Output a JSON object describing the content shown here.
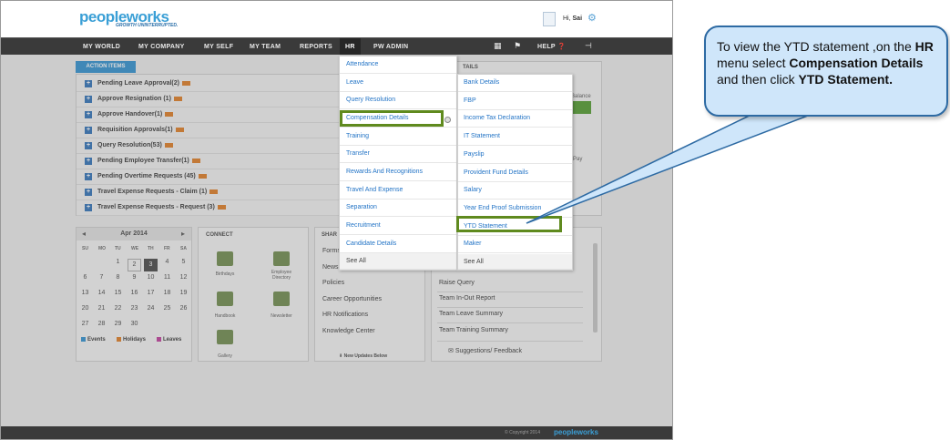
{
  "header": {
    "logo_text": "peopleworks",
    "tagline": "GROWTH UNINTERRUPTED.",
    "greeting": "Hi,",
    "user_name": "Sai"
  },
  "nav": {
    "items": [
      "MY WORLD",
      "MY COMPANY",
      "MY SELF",
      "MY TEAM",
      "REPORTS",
      "HR",
      "PW ADMIN"
    ],
    "help_label": "HELP"
  },
  "action_items": {
    "tab_label": "ACTION ITEMS",
    "rows": [
      "Pending Leave Approval(2)",
      "Approve Resignation (1)",
      "Approve Handover(1)",
      "Requisition Approvals(1)",
      "Query Resolution(53)",
      "Pending Employee Transfer(1)",
      "Pending Overtime Requests (45)",
      "Travel Expense Requests - Claim (1)",
      "Travel Expense Requests - Request (3)"
    ]
  },
  "calendar": {
    "month": "Apr 2014",
    "dow": [
      "SU",
      "MO",
      "TU",
      "WE",
      "TH",
      "FR",
      "SA"
    ],
    "weeks": [
      [
        "",
        "",
        "1",
        "2",
        "3",
        "4",
        "5"
      ],
      [
        "6",
        "7",
        "8",
        "9",
        "10",
        "11",
        "12"
      ],
      [
        "13",
        "14",
        "15",
        "16",
        "17",
        "18",
        "19"
      ],
      [
        "20",
        "21",
        "22",
        "23",
        "24",
        "25",
        "26"
      ],
      [
        "27",
        "28",
        "29",
        "30",
        "",
        "",
        ""
      ]
    ],
    "today": "3",
    "legend": [
      {
        "label": "Events",
        "color": "#2b8fd0"
      },
      {
        "label": "Holidays",
        "color": "#e07a1f"
      },
      {
        "label": "Leaves",
        "color": "#c0399a"
      }
    ]
  },
  "connect": {
    "title": "CONNECT",
    "items": [
      "Birthdays",
      "Employee Directory",
      "Handbook",
      "Newsletter",
      "Gallery"
    ]
  },
  "share": {
    "title": "SHAR",
    "items": [
      "Forms",
      "News",
      "Policies",
      "Career Opportunities",
      "HR Notifications",
      "Knowledge Center"
    ],
    "footer": "New Updates Below"
  },
  "right_top": {
    "title": "TAILS",
    "balance_label": "Balance",
    "pay_label": "Pay"
  },
  "right_bottom": {
    "items": [
      "Raise Query",
      "Team In-Out Report",
      "Team Leave Summary",
      "Team Training Summary",
      "Suggestions/ Feedback"
    ]
  },
  "hr_menu": {
    "items": [
      "Attendance",
      "Leave",
      "Query Resolution",
      "Compensation Details",
      "Training",
      "Transfer",
      "Rewards And Recognitions",
      "Travel And Expense",
      "Separation",
      "Recruitment",
      "Candidate Details",
      "See All"
    ]
  },
  "compensation_submenu": {
    "items": [
      "Bank Details",
      "FBP",
      "Income Tax Declaration",
      "IT Statement",
      "Payslip",
      "Provident Fund Details",
      "Salary",
      "Year End Proof Submission",
      "YTD Statement",
      "Maker",
      "See All"
    ]
  },
  "footer": {
    "copyright": "© Copyright 2014",
    "logo_text": "peopleworks"
  },
  "callout": {
    "text_1": "To view the YTD statement ,on the ",
    "bold_1": "HR",
    "text_2": " menu select ",
    "bold_2": "Compensation Details",
    "text_3": " and then click ",
    "bold_3": "YTD Statement."
  },
  "colors": {
    "highlight": "#5f8a1e",
    "link": "#2374c6",
    "nav_bg": "#3a3a3a",
    "callout_bg": "#cfe6fa",
    "callout_border": "#2d6aa3"
  }
}
